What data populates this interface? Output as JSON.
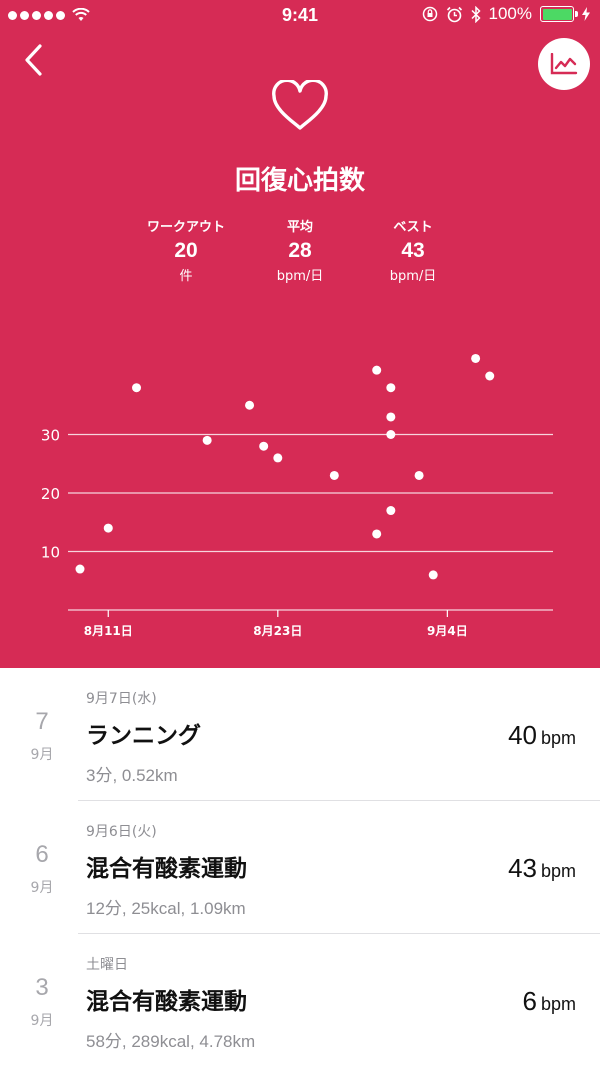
{
  "status_bar": {
    "time": "9:41",
    "battery": "100%"
  },
  "header": {
    "title": "回復心拍数"
  },
  "stats": [
    {
      "label": "ワークアウト",
      "value": "20",
      "unit": "件"
    },
    {
      "label": "平均",
      "value": "28",
      "unit": "bpm/日"
    },
    {
      "label": "ベスト",
      "value": "43",
      "unit": "bpm/日"
    }
  ],
  "chart_data": {
    "type": "scatter",
    "x_ticks": [
      "8月11日",
      "8月23日",
      "9月4日"
    ],
    "y_ticks": [
      10,
      20,
      30
    ],
    "ylim": [
      0,
      43
    ],
    "xlim": [
      "2016-08-09",
      "2016-09-09"
    ],
    "grid": true,
    "points": [
      {
        "x": "2016-08-09",
        "y": 7
      },
      {
        "x": "2016-08-11",
        "y": 14
      },
      {
        "x": "2016-08-13",
        "y": 38
      },
      {
        "x": "2016-08-18",
        "y": 29
      },
      {
        "x": "2016-08-21",
        "y": 35
      },
      {
        "x": "2016-08-22",
        "y": 28
      },
      {
        "x": "2016-08-23",
        "y": 26
      },
      {
        "x": "2016-08-27",
        "y": 23
      },
      {
        "x": "2016-08-30",
        "y": 41
      },
      {
        "x": "2016-08-30",
        "y": 13
      },
      {
        "x": "2016-08-31",
        "y": 38
      },
      {
        "x": "2016-08-31",
        "y": 33
      },
      {
        "x": "2016-08-31",
        "y": 30
      },
      {
        "x": "2016-08-31",
        "y": 17
      },
      {
        "x": "2016-09-02",
        "y": 23
      },
      {
        "x": "2016-09-03",
        "y": 6
      },
      {
        "x": "2016-09-06",
        "y": 43
      },
      {
        "x": "2016-09-07",
        "y": 40
      }
    ]
  },
  "workouts": [
    {
      "day": "7",
      "month": "9月",
      "date": "9月7日(水)",
      "name": "ランニング",
      "details": "3分, 0.52km",
      "bpm": "40",
      "bpm_unit": "bpm"
    },
    {
      "day": "6",
      "month": "9月",
      "date": "9月6日(火)",
      "name": "混合有酸素運動",
      "details": "12分, 25kcal, 1.09km",
      "bpm": "43",
      "bpm_unit": "bpm"
    },
    {
      "day": "3",
      "month": "9月",
      "date": "土曜日",
      "name": "混合有酸素運動",
      "details": "58分, 289kcal, 4.78km",
      "bpm": "6",
      "bpm_unit": "bpm"
    }
  ]
}
